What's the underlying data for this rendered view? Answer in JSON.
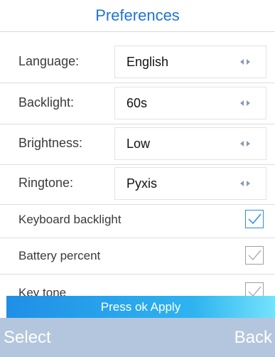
{
  "header": {
    "title": "Preferences"
  },
  "settings": [
    {
      "label": "Language:",
      "value": "English"
    },
    {
      "label": "Backlight:",
      "value": "60s"
    },
    {
      "label": "Brightness:",
      "value": "Low"
    },
    {
      "label": "Ringtone:",
      "value": "Pyxis"
    }
  ],
  "toggles": [
    {
      "label": "Keyboard backlight",
      "checked": true
    },
    {
      "label": "Battery percent",
      "checked": false
    },
    {
      "label": "Key tone",
      "checked": false
    }
  ],
  "apply_hint": "Press ok Apply",
  "softkeys": {
    "left": "Select",
    "right": "Back"
  },
  "colors": {
    "accent": "#1f73d6",
    "softkey_bar": "#b3c6dd",
    "apply_gradient_start": "#1f8fe6",
    "apply_gradient_end": "#74e3fb",
    "check_active": "#2e8ce6",
    "check_inactive": "#9aa0a6"
  },
  "icons": {
    "selector_arrows": "left-right-arrows-icon",
    "check": "checkmark-icon"
  }
}
